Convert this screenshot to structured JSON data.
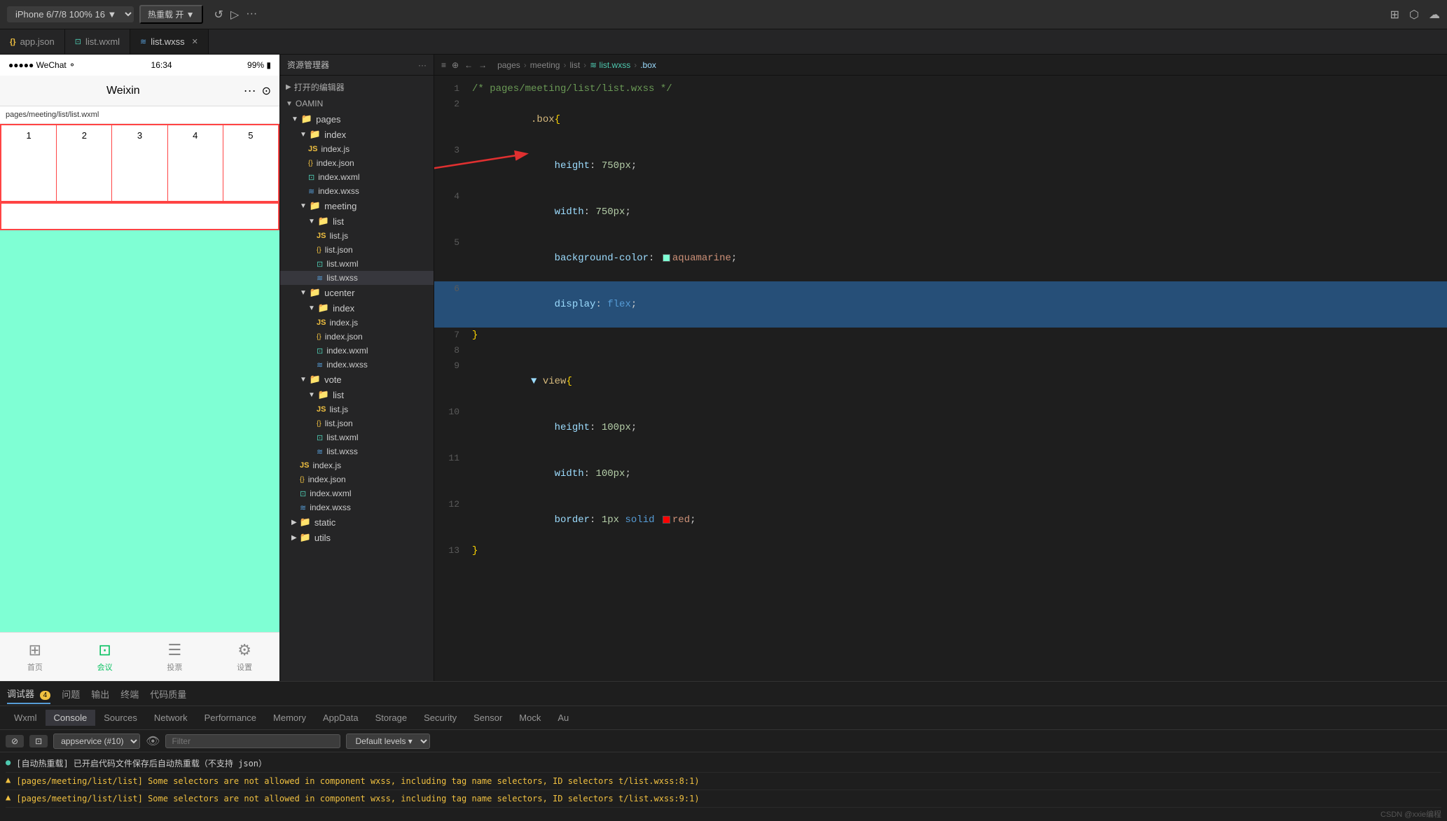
{
  "topbar": {
    "device": "iPhone 6/7/8 100% 16 ▼",
    "hot_reload": "热重载 开 ▼",
    "dots": "···",
    "icons": [
      "↺",
      "▷",
      "···",
      "⊞",
      "⬡",
      "☁"
    ]
  },
  "tabs": [
    {
      "id": "app-json",
      "label": "app.json",
      "icon": "json",
      "active": false
    },
    {
      "id": "list-wxml",
      "label": "list.wxml",
      "icon": "wxml",
      "active": false
    },
    {
      "id": "list-wxss",
      "label": "list.wxss",
      "icon": "wxss",
      "active": true
    }
  ],
  "breadcrumb": {
    "parts": [
      "pages",
      "meeting",
      "list",
      "list.wxss",
      ".box"
    ],
    "nav_icons": [
      "≡",
      "⊕",
      "←",
      "→"
    ]
  },
  "file_tree": {
    "header": "资源管理器",
    "opened_editors": "打开的编辑器",
    "root": "OAMIN",
    "items": [
      {
        "type": "folder",
        "name": "pages",
        "indent": 1,
        "expanded": true
      },
      {
        "type": "folder",
        "name": "index",
        "indent": 2,
        "expanded": true
      },
      {
        "type": "file",
        "name": "index.js",
        "ext": "js",
        "indent": 3
      },
      {
        "type": "file",
        "name": "index.json",
        "ext": "json",
        "indent": 3
      },
      {
        "type": "file",
        "name": "index.wxml",
        "ext": "wxml",
        "indent": 3
      },
      {
        "type": "file",
        "name": "index.wxss",
        "ext": "wxss",
        "indent": 3
      },
      {
        "type": "folder",
        "name": "meeting",
        "indent": 2,
        "expanded": true
      },
      {
        "type": "folder",
        "name": "list",
        "indent": 3,
        "expanded": true
      },
      {
        "type": "file",
        "name": "list.js",
        "ext": "js",
        "indent": 4
      },
      {
        "type": "file",
        "name": "list.json",
        "ext": "json",
        "indent": 4
      },
      {
        "type": "file",
        "name": "list.wxml",
        "ext": "wxml",
        "indent": 4
      },
      {
        "type": "file",
        "name": "list.wxss",
        "ext": "wxss",
        "indent": 4,
        "active": true
      },
      {
        "type": "folder",
        "name": "ucenter",
        "indent": 2,
        "expanded": true
      },
      {
        "type": "folder",
        "name": "index",
        "indent": 3,
        "expanded": true
      },
      {
        "type": "file",
        "name": "index.js",
        "ext": "js",
        "indent": 4
      },
      {
        "type": "file",
        "name": "index.json",
        "ext": "json",
        "indent": 4
      },
      {
        "type": "file",
        "name": "index.wxml",
        "ext": "wxml",
        "indent": 4
      },
      {
        "type": "file",
        "name": "index.wxss",
        "ext": "wxss",
        "indent": 4
      },
      {
        "type": "folder",
        "name": "vote",
        "indent": 2,
        "expanded": true
      },
      {
        "type": "folder",
        "name": "list",
        "indent": 3,
        "expanded": true
      },
      {
        "type": "file",
        "name": "list.js",
        "ext": "js",
        "indent": 4
      },
      {
        "type": "file",
        "name": "list.json",
        "ext": "json",
        "indent": 4
      },
      {
        "type": "file",
        "name": "list.wxml",
        "ext": "wxml",
        "indent": 4
      },
      {
        "type": "file",
        "name": "list.wxss",
        "ext": "wxss",
        "indent": 4
      },
      {
        "type": "file",
        "name": "index.js",
        "ext": "js",
        "indent": 2
      },
      {
        "type": "file",
        "name": "index.json",
        "ext": "json",
        "indent": 2
      },
      {
        "type": "file",
        "name": "index.wxml",
        "ext": "wxml",
        "indent": 2
      },
      {
        "type": "file",
        "name": "index.wxss",
        "ext": "wxss",
        "indent": 2
      },
      {
        "type": "folder",
        "name": "static",
        "indent": 1
      },
      {
        "type": "folder",
        "name": "utils",
        "indent": 1
      }
    ]
  },
  "code": {
    "filename_comment": "/* pages/meeting/list/list.wxss */",
    "lines": [
      {
        "num": 1,
        "content": "/* pages/meeting/list/list.wxss */",
        "type": "comment"
      },
      {
        "num": 2,
        "content": ".box{",
        "type": "selector"
      },
      {
        "num": 3,
        "content": "    height: 750px;",
        "type": "prop"
      },
      {
        "num": 4,
        "content": "    width: 750px;",
        "type": "prop"
      },
      {
        "num": 5,
        "content": "    background-color:  aquamarine;",
        "type": "prop-color",
        "color": "#7fffd4",
        "color_name": "aquamarine"
      },
      {
        "num": 6,
        "content": "    display: flex;",
        "type": "prop-highlight",
        "highlighted": true
      },
      {
        "num": 7,
        "content": "}",
        "type": "brace"
      },
      {
        "num": 8,
        "content": "",
        "type": "empty"
      },
      {
        "num": 9,
        "content": "view{",
        "type": "selector2"
      },
      {
        "num": 10,
        "content": "    height: 100px;",
        "type": "prop"
      },
      {
        "num": 11,
        "content": "    width: 100px;",
        "type": "prop"
      },
      {
        "num": 12,
        "content": "    border: 1px solid  red;",
        "type": "prop-color",
        "color": "#ff0000",
        "color_name": "red"
      },
      {
        "num": 13,
        "content": "}",
        "type": "brace"
      }
    ]
  },
  "phone": {
    "status_bar": {
      "left": "●●●●● WeChat ⚬",
      "time": "16:34",
      "right": "99% ■"
    },
    "nav_title": "Weixin",
    "path": "pages/meeting/list/list.wxml",
    "grid_numbers": [
      "1",
      "2",
      "3",
      "4",
      "5"
    ],
    "bottom_tabs": [
      {
        "label": "首页",
        "icon": "⊞",
        "active": false
      },
      {
        "label": "会议",
        "icon": "⊡",
        "active": true
      },
      {
        "label": "投票",
        "icon": "☰",
        "active": false
      },
      {
        "label": "设置",
        "icon": "⚙",
        "active": false
      }
    ]
  },
  "bottom_panel": {
    "tabs": [
      {
        "label": "调试器",
        "badge": "4",
        "active": true
      },
      {
        "label": "问题",
        "active": false
      },
      {
        "label": "输出",
        "active": false
      },
      {
        "label": "终端",
        "active": false
      },
      {
        "label": "代码质量",
        "active": false
      }
    ],
    "sub_tabs": [
      "Wxml",
      "Console",
      "Sources",
      "Network",
      "Performance",
      "Memory",
      "AppData",
      "Storage",
      "Security",
      "Sensor",
      "Mock",
      "Au"
    ],
    "active_sub_tab": "Console",
    "appservice_select": "appservice (#10)",
    "filter_placeholder": "Filter",
    "levels": "Default levels ▾",
    "messages": [
      {
        "type": "info",
        "text": "● [自动热重载] 已开启代码文件保存后自动热重载（不支持 json）"
      },
      {
        "type": "warn",
        "text": "▲ [pages/meeting/list/list] Some selectors are not allowed in component wxss, including tag name selectors, ID selectors t/list.wxss:8:1)"
      },
      {
        "type": "warn",
        "text": "▲ [pages/meeting/list/list] Some selectors are not allowed in component wxss, including tag name selectors, ID selectors t/list.wxss:9:1)"
      }
    ]
  },
  "watermark": "CSDN @xxie编程"
}
